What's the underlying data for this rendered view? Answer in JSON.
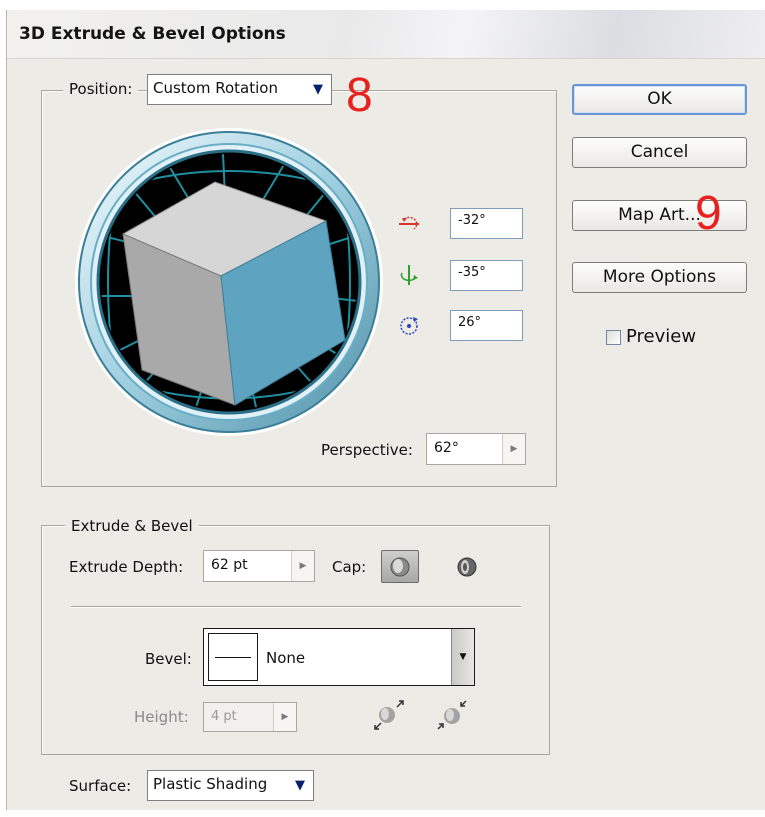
{
  "window": {
    "title": "3D Extrude & Bevel Options"
  },
  "position": {
    "label": "Position:",
    "value": "Custom Rotation",
    "rotations": [
      {
        "icon": "x-axis-rotation-icon",
        "color": "#d9342b",
        "value": "-32°"
      },
      {
        "icon": "y-axis-rotation-icon",
        "color": "#2e9e35",
        "value": "-35°"
      },
      {
        "icon": "z-axis-rotation-icon",
        "color": "#2b43c8",
        "value": "26°"
      }
    ],
    "perspective_label": "Perspective:",
    "perspective_value": "62°"
  },
  "extrude": {
    "legend": "Extrude & Bevel",
    "depth_label": "Extrude Depth:",
    "depth_value": "62 pt",
    "cap_label": "Cap:",
    "bevel_label": "Bevel:",
    "bevel_value": "None",
    "height_label": "Height:",
    "height_value": "4 pt"
  },
  "surface": {
    "label": "Surface:",
    "value": "Plastic Shading"
  },
  "buttons": {
    "ok": "OK",
    "cancel": "Cancel",
    "map_art": "Map Art...",
    "more_options": "More Options"
  },
  "preview": {
    "label": "Preview",
    "checked": false
  },
  "annotations": {
    "a": "8",
    "b": "9"
  },
  "colors": {
    "dialog_bg": "#ecebe6",
    "cube_top": "#d6d6d6",
    "cube_left": "#a9a9a9",
    "cube_right": "#5ea3bf",
    "grid_lines": "#1f8fa0",
    "annotation": "#e8211e"
  }
}
